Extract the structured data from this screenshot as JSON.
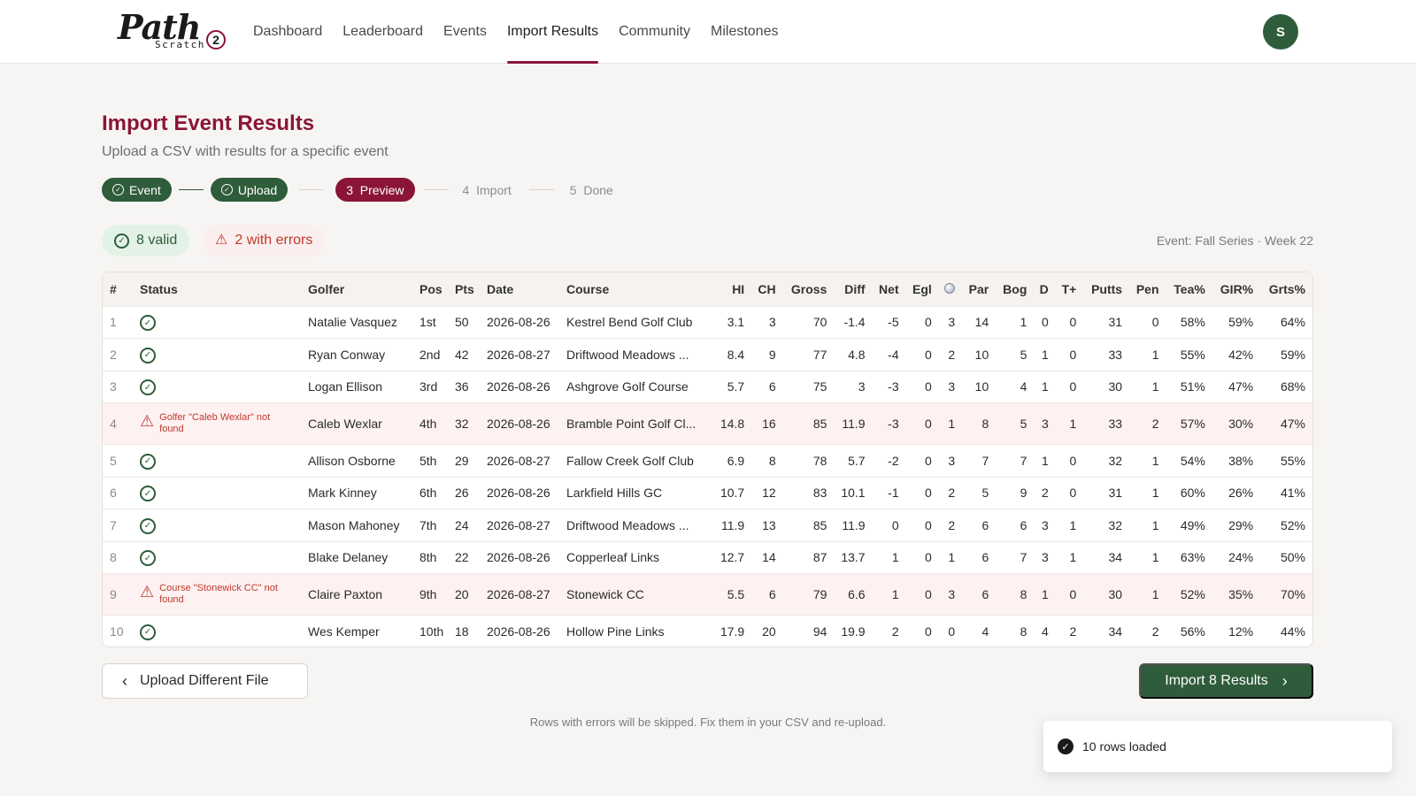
{
  "brand": {
    "script": "Path",
    "sub": "Scratch",
    "mark": "2",
    "accent": "#8a1538",
    "green": "#2f5c3a"
  },
  "nav": [
    {
      "label": "Dashboard",
      "active": false
    },
    {
      "label": "Leaderboard",
      "active": false
    },
    {
      "label": "Events",
      "active": false
    },
    {
      "label": "Import Results",
      "active": true
    },
    {
      "label": "Community",
      "active": false
    },
    {
      "label": "Milestones",
      "active": false
    }
  ],
  "user": {
    "initial": "S"
  },
  "page": {
    "title": "Import Event Results",
    "subtitle": "Upload a CSV with results for a specific event"
  },
  "steps": [
    {
      "label": "Event",
      "state": "done"
    },
    {
      "label": "Upload",
      "state": "done"
    },
    {
      "label": "3  Preview",
      "state": "current"
    },
    {
      "label": "4  Import",
      "state": "future"
    },
    {
      "label": "5  Done",
      "state": "future"
    }
  ],
  "summary": {
    "valid": "8 valid",
    "errors": "2 with errors",
    "event": "Event: Fall Series · Week 22"
  },
  "table": {
    "headers": [
      "#",
      "Status",
      "Golfer",
      "Pos",
      "Pts",
      "Date",
      "Course",
      "HI",
      "CH",
      "Gross",
      "Diff",
      "Net",
      "Egl",
      "",
      "Par",
      "Bog",
      "D",
      "T+",
      "Putts",
      "Pen",
      "Tea%",
      "GIR%",
      "Grts%"
    ],
    "rows": [
      {
        "n": "1",
        "error": "",
        "golfer": "Natalie Vasquez",
        "pos": "1st",
        "pts": "50",
        "date": "2026-08-26",
        "course": "Kestrel Bend Golf Club",
        "hi": "3.1",
        "ch": "3",
        "gross": "70",
        "diff": "-1.4",
        "net": "-5",
        "egl": "0",
        "bird": "3",
        "par": "14",
        "bog": "1",
        "d": "0",
        "tp": "0",
        "putts": "31",
        "pen": "0",
        "tea": "58%",
        "gir": "59%",
        "grts": "64%"
      },
      {
        "n": "2",
        "error": "",
        "golfer": "Ryan Conway",
        "pos": "2nd",
        "pts": "42",
        "date": "2026-08-27",
        "course": "Driftwood Meadows ...",
        "hi": "8.4",
        "ch": "9",
        "gross": "77",
        "diff": "4.8",
        "net": "-4",
        "egl": "0",
        "bird": "2",
        "par": "10",
        "bog": "5",
        "d": "1",
        "tp": "0",
        "putts": "33",
        "pen": "1",
        "tea": "55%",
        "gir": "42%",
        "grts": "59%"
      },
      {
        "n": "3",
        "error": "",
        "golfer": "Logan Ellison",
        "pos": "3rd",
        "pts": "36",
        "date": "2026-08-26",
        "course": "Ashgrove Golf Course",
        "hi": "5.7",
        "ch": "6",
        "gross": "75",
        "diff": "3",
        "net": "-3",
        "egl": "0",
        "bird": "3",
        "par": "10",
        "bog": "4",
        "d": "1",
        "tp": "0",
        "putts": "30",
        "pen": "1",
        "tea": "51%",
        "gir": "47%",
        "grts": "68%"
      },
      {
        "n": "4",
        "error": "Golfer \"Caleb Wexlar\" not found",
        "golfer": "Caleb Wexlar",
        "pos": "4th",
        "pts": "32",
        "date": "2026-08-26",
        "course": "Bramble Point Golf Cl...",
        "hi": "14.8",
        "ch": "16",
        "gross": "85",
        "diff": "11.9",
        "net": "-3",
        "egl": "0",
        "bird": "1",
        "par": "8",
        "bog": "5",
        "d": "3",
        "tp": "1",
        "putts": "33",
        "pen": "2",
        "tea": "57%",
        "gir": "30%",
        "grts": "47%"
      },
      {
        "n": "5",
        "error": "",
        "golfer": "Allison Osborne",
        "pos": "5th",
        "pts": "29",
        "date": "2026-08-27",
        "course": "Fallow Creek Golf Club",
        "hi": "6.9",
        "ch": "8",
        "gross": "78",
        "diff": "5.7",
        "net": "-2",
        "egl": "0",
        "bird": "3",
        "par": "7",
        "bog": "7",
        "d": "1",
        "tp": "0",
        "putts": "32",
        "pen": "1",
        "tea": "54%",
        "gir": "38%",
        "grts": "55%"
      },
      {
        "n": "6",
        "error": "",
        "golfer": "Mark Kinney",
        "pos": "6th",
        "pts": "26",
        "date": "2026-08-26",
        "course": "Larkfield Hills GC",
        "hi": "10.7",
        "ch": "12",
        "gross": "83",
        "diff": "10.1",
        "net": "-1",
        "egl": "0",
        "bird": "2",
        "par": "5",
        "bog": "9",
        "d": "2",
        "tp": "0",
        "putts": "31",
        "pen": "1",
        "tea": "60%",
        "gir": "26%",
        "grts": "41%"
      },
      {
        "n": "7",
        "error": "",
        "golfer": "Mason Mahoney",
        "pos": "7th",
        "pts": "24",
        "date": "2026-08-27",
        "course": "Driftwood Meadows ...",
        "hi": "11.9",
        "ch": "13",
        "gross": "85",
        "diff": "11.9",
        "net": "0",
        "egl": "0",
        "bird": "2",
        "par": "6",
        "bog": "6",
        "d": "3",
        "tp": "1",
        "putts": "32",
        "pen": "1",
        "tea": "49%",
        "gir": "29%",
        "grts": "52%"
      },
      {
        "n": "8",
        "error": "",
        "golfer": "Blake Delaney",
        "pos": "8th",
        "pts": "22",
        "date": "2026-08-26",
        "course": "Copperleaf Links",
        "hi": "12.7",
        "ch": "14",
        "gross": "87",
        "diff": "13.7",
        "net": "1",
        "egl": "0",
        "bird": "1",
        "par": "6",
        "bog": "7",
        "d": "3",
        "tp": "1",
        "putts": "34",
        "pen": "1",
        "tea": "63%",
        "gir": "24%",
        "grts": "50%"
      },
      {
        "n": "9",
        "error": "Course \"Stonewick CC\" not found",
        "golfer": "Claire Paxton",
        "pos": "9th",
        "pts": "20",
        "date": "2026-08-27",
        "course": "Stonewick CC",
        "hi": "5.5",
        "ch": "6",
        "gross": "79",
        "diff": "6.6",
        "net": "1",
        "egl": "0",
        "bird": "3",
        "par": "6",
        "bog": "8",
        "d": "1",
        "tp": "0",
        "putts": "30",
        "pen": "1",
        "tea": "52%",
        "gir": "35%",
        "grts": "70%"
      },
      {
        "n": "10",
        "error": "",
        "golfer": "Wes Kemper",
        "pos": "10th",
        "pts": "18",
        "date": "2026-08-26",
        "course": "Hollow Pine Links",
        "hi": "17.9",
        "ch": "20",
        "gross": "94",
        "diff": "19.9",
        "net": "2",
        "egl": "0",
        "bird": "0",
        "par": "4",
        "bog": "8",
        "d": "4",
        "tp": "2",
        "putts": "34",
        "pen": "2",
        "tea": "56%",
        "gir": "12%",
        "grts": "44%"
      }
    ]
  },
  "actions": {
    "back": "Upload Different File",
    "import": "Import 8 Results"
  },
  "footnote": "Rows with errors will be skipped. Fix them in your CSV and re-upload.",
  "toast": "10 rows loaded",
  "icons": {
    "ok": "check-circle-icon",
    "warn": "warning-triangle-icon",
    "birdie": "golf-ball-icon"
  }
}
